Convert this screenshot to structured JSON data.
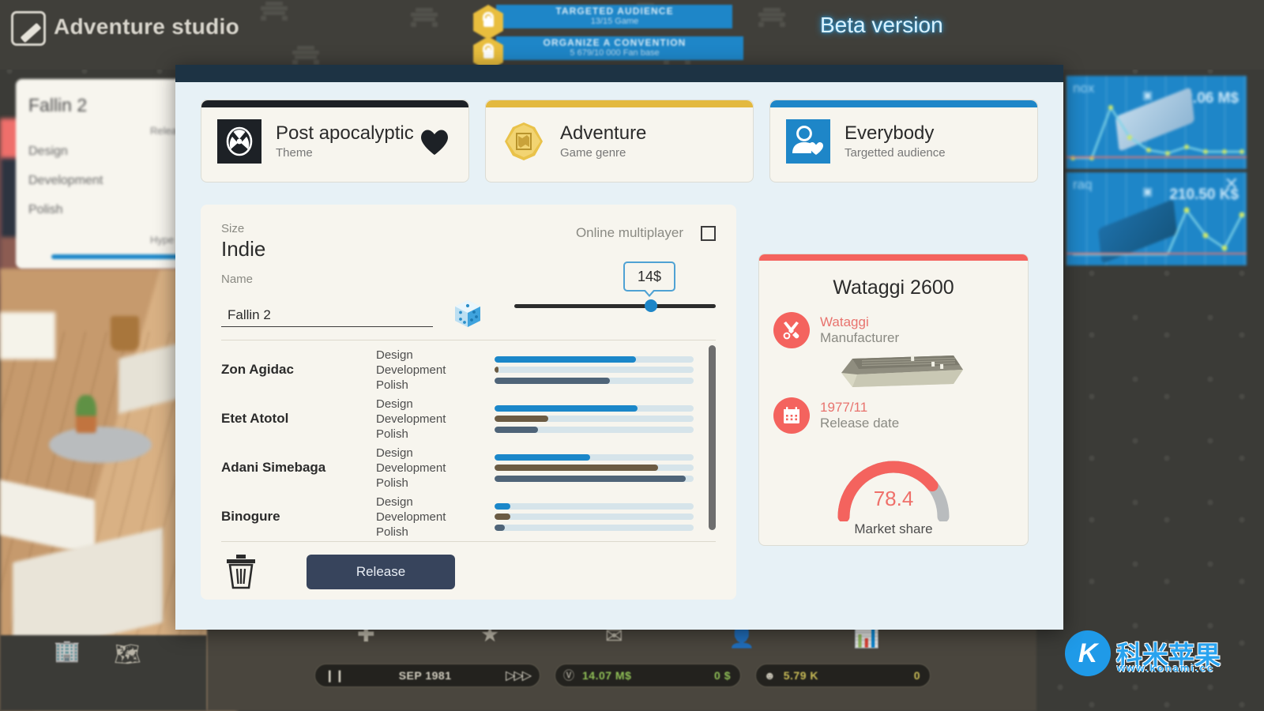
{
  "header": {
    "app_title": "Adventure studio",
    "logo_icon": "pencil-square-icon",
    "beta_label": "Beta version"
  },
  "quests": [
    {
      "title": "TARGETED AUDIENCE",
      "progress_text": "13/15 Game",
      "lock_icon": "lock-icon",
      "fill_pct": 88
    },
    {
      "title": "ORGANIZE A CONVENTION",
      "progress_text": "5 679/10 000 Fan base",
      "lock_icon": "lock-icon",
      "fill_pct": 92
    }
  ],
  "background": {
    "left_card": {
      "title": "Fallin 2",
      "release_label": "Relea",
      "stage_design": "Design",
      "stage_development": "Development",
      "stage_polish": "Polish",
      "hype_label": "Hype"
    },
    "game_cards": [
      {
        "name": "nox",
        "value": "2.06 M$",
        "close_icon": "close-icon",
        "stat_icon": "sales-icon"
      },
      {
        "name": "raq",
        "value": "210.50 K$",
        "close_icon": "close-icon",
        "stat_icon": "sales-icon"
      }
    ],
    "toolbar_icons": [
      "hospital-icon",
      "research-icon",
      "mail-icon",
      "staff-icon",
      "stats-icon",
      "building-icon",
      "map-icon"
    ],
    "status": {
      "pause_icon": "pause-icon",
      "date": "SEP 1981",
      "speed_icon": "fast-forward-icon",
      "money_icon": "money-icon",
      "money": "14.07 M$",
      "income": "0 $",
      "fans_icon": "fans-icon",
      "fans": "5.79 K",
      "fans_delta": "0"
    }
  },
  "watermark": {
    "logo_letter": "K",
    "text": "科米苹果",
    "url": "www.konami.cc"
  },
  "modal": {
    "cards": [
      {
        "id": "theme",
        "icon": "radiation-icon",
        "title": "Post apocalyptic",
        "subtitle": "Theme",
        "accent": "#1d2126",
        "favorite_icon": "heart-icon"
      },
      {
        "id": "genre",
        "icon": "map-badge-icon",
        "title": "Adventure",
        "subtitle": "Game genre",
        "accent": "#e3b93f"
      },
      {
        "id": "audience",
        "icon": "person-heart-icon",
        "title": "Everybody",
        "subtitle": "Targetted audience",
        "accent": "#1e86c8"
      }
    ],
    "form": {
      "size_label": "Size",
      "size_value": "Indie",
      "name_label": "Name",
      "name_value": "Fallin 2",
      "name_placeholder": "Name",
      "dice_icon": "dice-icon",
      "online_multiplayer_label": "Online multiplayer",
      "online_multiplayer_checked": false,
      "price_value": "14$",
      "price_pct": 68,
      "trash_icon": "trash-icon",
      "release_label": "Release",
      "stage_labels": [
        "Design",
        "Development",
        "Polish"
      ],
      "bar_colors": {
        "design": "#1b87c9",
        "development": "#6b5b43",
        "polish": "#4f6478",
        "track": "#d6e4ea"
      },
      "team": [
        {
          "name": "Zon Agidac",
          "design": 71,
          "development": 2,
          "polish": 58
        },
        {
          "name": "Etet Atotol",
          "design": 72,
          "development": 27,
          "polish": 22
        },
        {
          "name": "Adani Simebaga",
          "design": 48,
          "development": 82,
          "polish": 96
        },
        {
          "name": "Binogure",
          "design": 8,
          "development": 8,
          "polish": 5
        }
      ]
    },
    "console": {
      "title": "Wataggi 2600",
      "accent": "#f4635e",
      "manufacturer_icon": "tools-icon",
      "manufacturer_value": "Wataggi",
      "manufacturer_label": "Manufacturer",
      "release_icon": "calendar-icon",
      "release_value": "1977/11",
      "release_label": "Release date",
      "market_share_value": "78.4",
      "market_share_label": "Market share",
      "market_share_pct": 78.4
    }
  }
}
